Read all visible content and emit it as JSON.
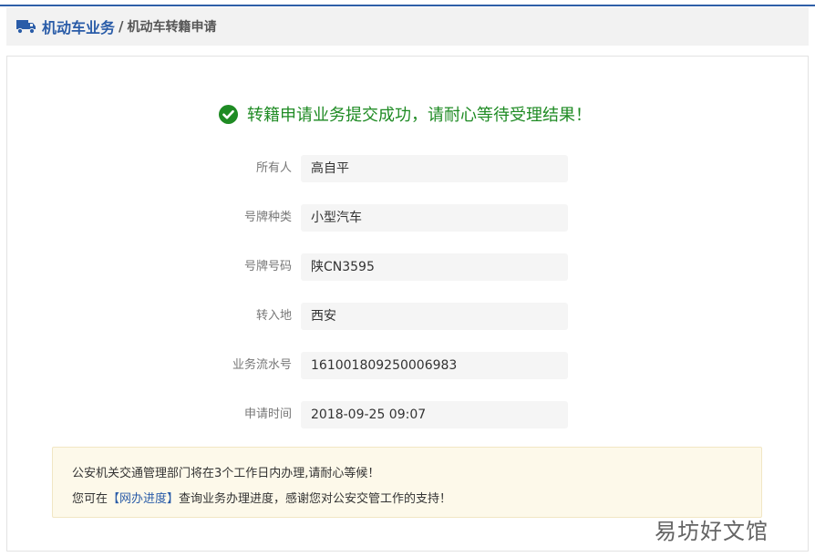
{
  "breadcrumb": {
    "root": "机动车业务",
    "separator": "/",
    "current": "机动车转籍申请",
    "icon": "truck-icon"
  },
  "result": {
    "icon": "check-circle-icon",
    "message": "转籍申请业务提交成功，请耐心等待受理结果！",
    "color": "#1f8b24"
  },
  "fields": [
    {
      "label": "所有人",
      "value": "高自平"
    },
    {
      "label": "号牌种类",
      "value": "小型汽车"
    },
    {
      "label": "号牌号码",
      "value": "陕CN3595"
    },
    {
      "label": "转入地",
      "value": "西安"
    },
    {
      "label": "业务流水号",
      "value": "161001809250006983"
    },
    {
      "label": "申请时间",
      "value": "2018-09-25 09:07"
    }
  ],
  "notice": {
    "line1": "公安机关交通管理部门将在3个工作日内办理,请耐心等候！",
    "line2_prefix": "您可在",
    "link_text": "【网办进度】",
    "line2_suffix": "查询业务办理进度，感谢您对公安交管工作的支持！"
  },
  "watermark": "易坊好文馆",
  "colors": {
    "accent": "#2a5ca8",
    "success": "#1f8b24",
    "notice_bg": "#fdf9ea"
  }
}
